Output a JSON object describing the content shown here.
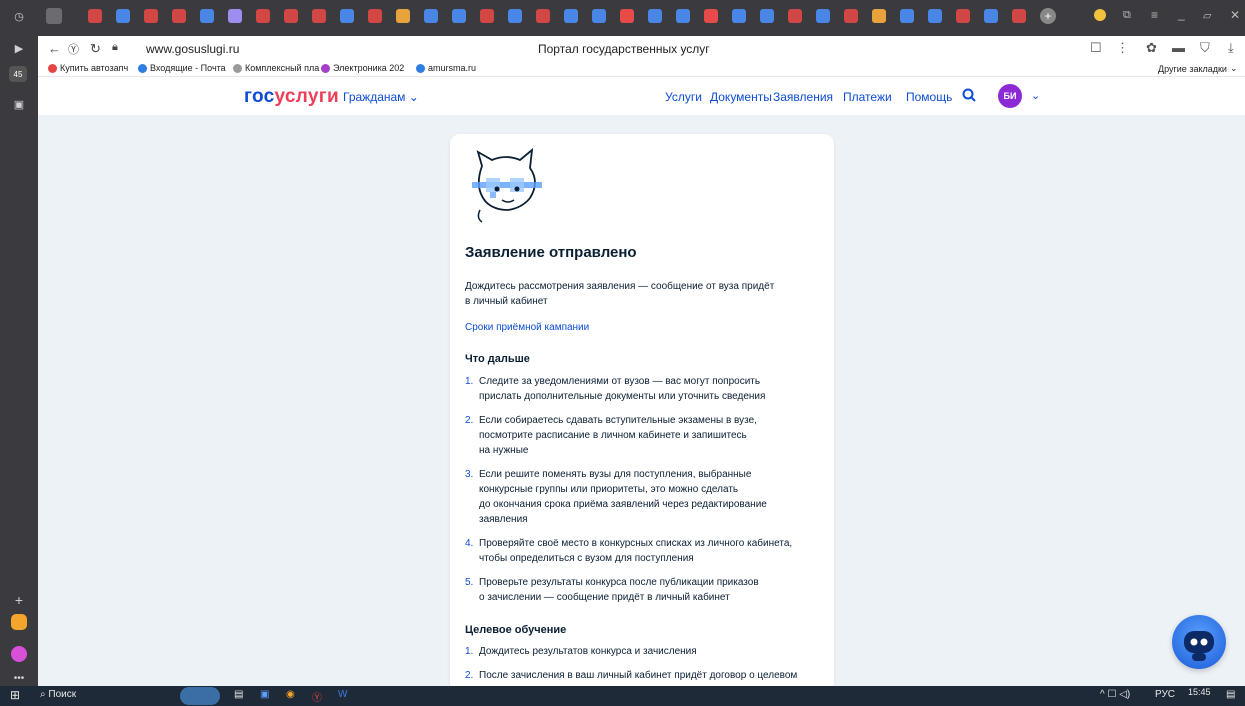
{
  "browser": {
    "url": "www.gosuslugi.ru",
    "page_title": "Портал государственных услуг",
    "sidebar_badge": "45",
    "tab_colors": [
      "#d24646",
      "#4a86e8",
      "#d24646",
      "#d24646",
      "#4a86e8",
      "#9c8df0",
      "#d24646",
      "#d24646",
      "#d24646",
      "#4a86e8",
      "#d24646",
      "#e8a33d",
      "#4a86e8",
      "#4a86e8",
      "#d24646",
      "#4a86e8",
      "#d24646",
      "#4a86e8",
      "#4a86e8",
      "#e84a4a",
      "#4a86e8",
      "#4a86e8",
      "#e84a4a",
      "#4a86e8",
      "#4a86e8",
      "#d24646",
      "#4a86e8",
      "#d24646",
      "#e8a33d",
      "#4a86e8",
      "#4a86e8",
      "#d24646",
      "#4a86e8",
      "#d24646"
    ]
  },
  "bookmarks": {
    "items": [
      "Купить автозапч",
      "Входящие - Почта",
      "Комплексный пла",
      "Электроника 202",
      "amursma.ru"
    ],
    "other": "Другие закладки"
  },
  "site": {
    "logo_part1": "гос",
    "logo_part2": "услуги",
    "citizens": "Гражданам",
    "menu": [
      "Услуги",
      "Документы",
      "Заявления",
      "Платежи",
      "Помощь"
    ],
    "avatar_initials": "БИ"
  },
  "content": {
    "title": "Заявление отправлено",
    "wait_text_1": "Дождитесь рассмотрения заявления — сообщение от вуза придёт",
    "wait_text_2": "в личный кабинет",
    "deadline_link": "Сроки приёмной кампании",
    "next_heading": "Что дальше",
    "next_items": [
      {
        "num": "1.",
        "lines": [
          "Следите за уведомлениями от вузов — вас могут попросить",
          "прислать дополнительные документы или уточнить сведения"
        ]
      },
      {
        "num": "2.",
        "lines": [
          "Если собираетесь сдавать вступительные экзамены в вузе,",
          "посмотрите расписание в личном кабинете и запишитесь",
          "на нужные"
        ]
      },
      {
        "num": "3.",
        "lines": [
          "Если решите поменять вузы для поступления, выбранные",
          "конкурсные группы или приоритеты, это можно сделать",
          "до окончания срока приёма заявлений через редактирование",
          "заявления"
        ]
      },
      {
        "num": "4.",
        "lines": [
          "Проверяйте своё место в конкурсных списках из личного кабинета,",
          "чтобы определиться с вузом для поступления"
        ]
      },
      {
        "num": "5.",
        "lines": [
          "Проверьте результаты конкурса после публикации приказов",
          "о зачислении — сообщение придёт в личный кабинет"
        ]
      }
    ],
    "target_heading": "Целевое обучение",
    "target_items": [
      {
        "num": "1.",
        "lines": [
          "Дождитесь результатов конкурса и зачисления"
        ]
      },
      {
        "num": "2.",
        "lines": [
          "После зачисления в ваш личный кабинет придёт договор о целевом"
        ]
      }
    ]
  },
  "taskbar": {
    "search": "Поиск",
    "lang": "РУС",
    "time": "15:45"
  }
}
